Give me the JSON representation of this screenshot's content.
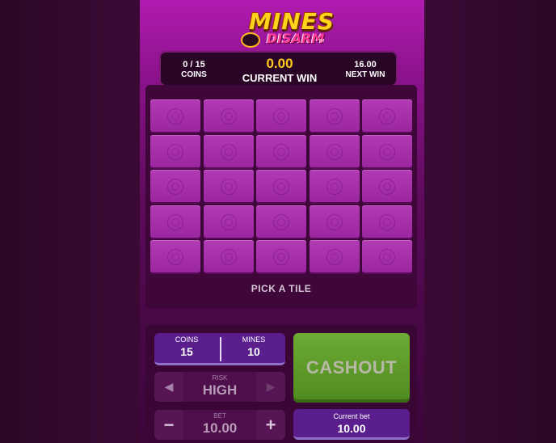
{
  "logo": {
    "line1": "MINES",
    "line2": "DISARM",
    "tm": "TM"
  },
  "header": {
    "coins_value": "0 / 15",
    "coins_label": "COINS",
    "win_value": "0.00",
    "win_label": "CURRENT WIN",
    "next_value": "16.00",
    "next_label": "NEXT WIN"
  },
  "board": {
    "rows": 5,
    "cols": 5,
    "prompt": "PICK A TILE"
  },
  "controls": {
    "coins_label": "COINS",
    "coins_value": "15",
    "mines_label": "MINES",
    "mines_value": "10",
    "risk_label": "RISK",
    "risk_value": "HIGH",
    "bet_label": "BET",
    "bet_value": "10.00",
    "minus": "−",
    "plus": "+",
    "left_arrow": "◀",
    "right_arrow": "▶",
    "cashout_label": "CASHOUT",
    "current_bet_label": "Current bet",
    "current_bet_value": "10.00"
  },
  "colors": {
    "cashout": "#5a9a28",
    "accent_gold": "#ffc81e",
    "panel": "#5a1f8c"
  }
}
